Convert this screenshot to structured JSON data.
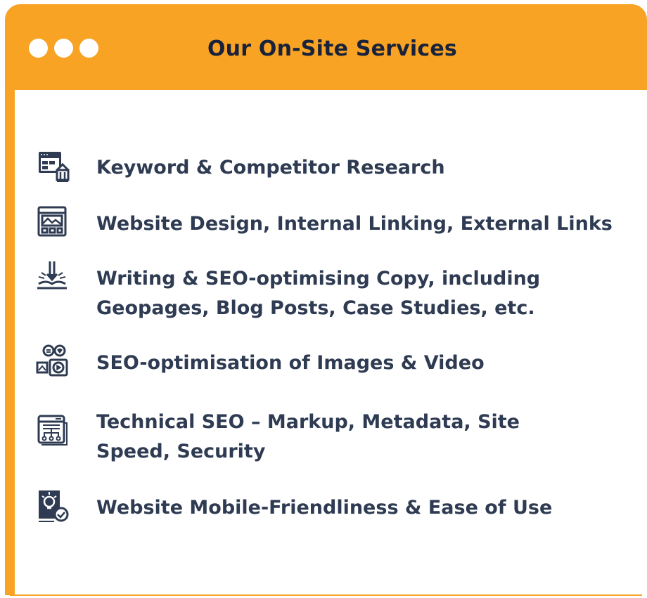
{
  "window": {
    "title": "Our On-Site Services",
    "accent_color": "#f8a323",
    "title_color": "#19223a",
    "text_color": "#2e3b52"
  },
  "services": [
    {
      "label": "Keyword & Competitor Research",
      "icon": "keyword-research-icon"
    },
    {
      "label": "Website Design, Internal Linking, External Links",
      "icon": "website-design-icon"
    },
    {
      "label_line1": "Writing & SEO-optimising Copy, including",
      "label_line2": "Geopages, Blog Posts, Case Studies, etc.",
      "icon": "writing-icon"
    },
    {
      "label": "SEO-optimisation of Images & Video",
      "icon": "image-video-icon"
    },
    {
      "label_line1": "Technical SEO – Markup, Metadata, Site",
      "label_line2": "Speed, Security",
      "icon": "technical-seo-icon"
    },
    {
      "label": "Website Mobile-Friendliness & Ease of Use",
      "icon": "mobile-friendly-icon"
    }
  ]
}
